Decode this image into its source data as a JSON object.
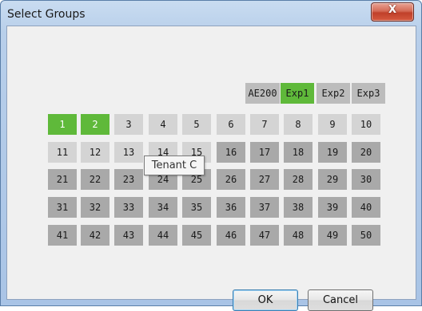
{
  "window": {
    "title": "Select Groups",
    "close_label": "X"
  },
  "expansion": [
    {
      "label": "AE200",
      "selected": false
    },
    {
      "label": "Exp1",
      "selected": true
    },
    {
      "label": "Exp2",
      "selected": false
    },
    {
      "label": "Exp3",
      "selected": false
    }
  ],
  "groups": [
    {
      "label": "1",
      "selected": true
    },
    {
      "label": "2",
      "selected": true
    },
    {
      "label": "3"
    },
    {
      "label": "4"
    },
    {
      "label": "5"
    },
    {
      "label": "6"
    },
    {
      "label": "7"
    },
    {
      "label": "8"
    },
    {
      "label": "9"
    },
    {
      "label": "10"
    },
    {
      "label": "11"
    },
    {
      "label": "12"
    },
    {
      "label": "13"
    },
    {
      "label": "14"
    },
    {
      "label": "15"
    },
    {
      "label": "16"
    },
    {
      "label": "17"
    },
    {
      "label": "18"
    },
    {
      "label": "19"
    },
    {
      "label": "20"
    },
    {
      "label": "21"
    },
    {
      "label": "22"
    },
    {
      "label": "23"
    },
    {
      "label": "24"
    },
    {
      "label": "25"
    },
    {
      "label": "26"
    },
    {
      "label": "27"
    },
    {
      "label": "28"
    },
    {
      "label": "29"
    },
    {
      "label": "30"
    },
    {
      "label": "31"
    },
    {
      "label": "32"
    },
    {
      "label": "33"
    },
    {
      "label": "34"
    },
    {
      "label": "35"
    },
    {
      "label": "36"
    },
    {
      "label": "37"
    },
    {
      "label": "38"
    },
    {
      "label": "39"
    },
    {
      "label": "40"
    },
    {
      "label": "41"
    },
    {
      "label": "42"
    },
    {
      "label": "43"
    },
    {
      "label": "44"
    },
    {
      "label": "45"
    },
    {
      "label": "46"
    },
    {
      "label": "47"
    },
    {
      "label": "48"
    },
    {
      "label": "49"
    },
    {
      "label": "50"
    }
  ],
  "tooltip": "Tenant C",
  "buttons": {
    "ok": "OK",
    "cancel": "Cancel"
  },
  "colors": {
    "selected": "#5fb93a",
    "unselected": "#a9a9a9",
    "light": "#d4d4d4"
  }
}
